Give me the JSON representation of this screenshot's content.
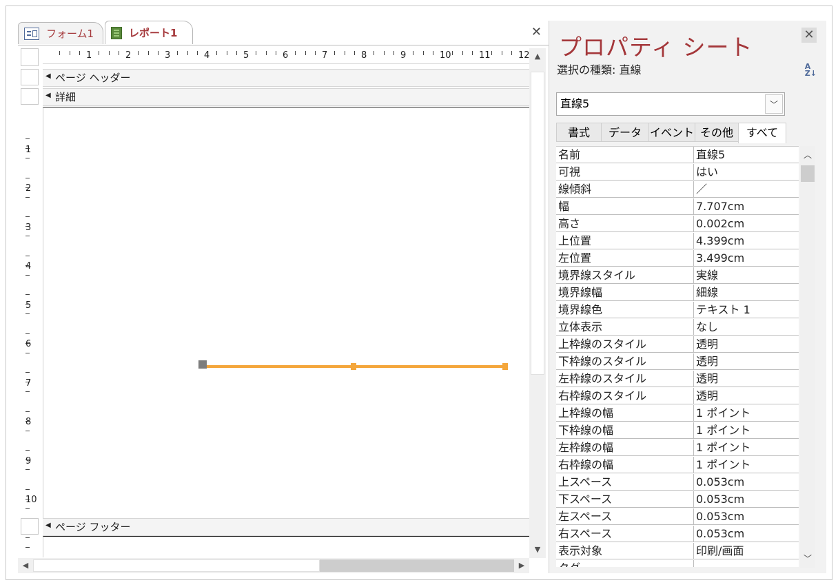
{
  "tabs": [
    {
      "label": "フォーム1",
      "icon": "form-icon"
    },
    {
      "label": "レポート1",
      "icon": "report-icon"
    }
  ],
  "doc_close_glyph": "✕",
  "ruler": {
    "labels": [
      "1",
      "2",
      "3",
      "4",
      "5",
      "6",
      "7",
      "8",
      "9",
      "10",
      "11",
      "12"
    ],
    "left_labels": [
      "1",
      "2",
      "3",
      "4",
      "5",
      "6",
      "7",
      "8",
      "9",
      "10"
    ]
  },
  "sections": {
    "page_header": "ページ ヘッダー",
    "detail": "詳細",
    "page_footer": "ページ フッター"
  },
  "property_sheet": {
    "title": "プロパティ シート",
    "selection_type": "選択の種類:  直線",
    "selected_object": "直線5",
    "sort_icon": "az-sort-icon",
    "close_glyph": "✕",
    "tabs": [
      "書式",
      "データ",
      "イベント",
      "その他",
      "すべて"
    ],
    "active_tab": "すべて",
    "rows": [
      {
        "key": "名前",
        "value": "直線5"
      },
      {
        "key": "可視",
        "value": "はい"
      },
      {
        "key": "線傾斜",
        "value": "／"
      },
      {
        "key": "幅",
        "value": "7.707cm"
      },
      {
        "key": "高さ",
        "value": "0.002cm"
      },
      {
        "key": "上位置",
        "value": "4.399cm"
      },
      {
        "key": "左位置",
        "value": "3.499cm"
      },
      {
        "key": "境界線スタイル",
        "value": "実線"
      },
      {
        "key": "境界線幅",
        "value": "細線"
      },
      {
        "key": "境界線色",
        "value": "テキスト 1"
      },
      {
        "key": "立体表示",
        "value": "なし"
      },
      {
        "key": "上枠線のスタイル",
        "value": "透明"
      },
      {
        "key": "下枠線のスタイル",
        "value": "透明"
      },
      {
        "key": "左枠線のスタイル",
        "value": "透明"
      },
      {
        "key": "右枠線のスタイル",
        "value": "透明"
      },
      {
        "key": "上枠線の幅",
        "value": "1 ポイント"
      },
      {
        "key": "下枠線の幅",
        "value": "1 ポイント"
      },
      {
        "key": "左枠線の幅",
        "value": "1 ポイント"
      },
      {
        "key": "右枠線の幅",
        "value": "1 ポイント"
      },
      {
        "key": "上スペース",
        "value": "0.053cm"
      },
      {
        "key": "下スペース",
        "value": "0.053cm"
      },
      {
        "key": "左スペース",
        "value": "0.053cm"
      },
      {
        "key": "右スペース",
        "value": "0.053cm"
      },
      {
        "key": "表示対象",
        "value": "印刷/画面"
      },
      {
        "key": "タグ",
        "value": ""
      }
    ]
  },
  "colors": {
    "accent": "#a4373a",
    "line_selected": "#f4a63b"
  }
}
